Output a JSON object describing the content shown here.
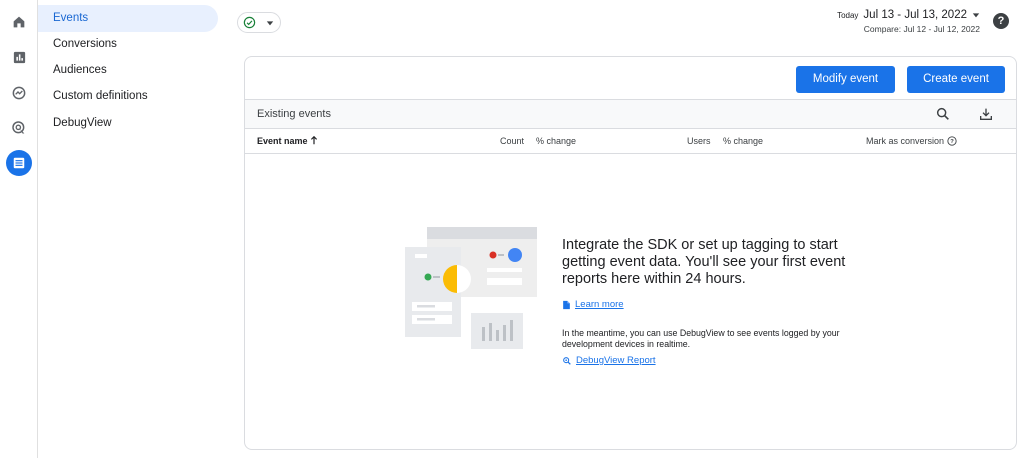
{
  "rail": {
    "items": [
      {
        "name": "home-icon"
      },
      {
        "name": "reports-icon"
      },
      {
        "name": "explore-icon"
      },
      {
        "name": "advertising-icon"
      },
      {
        "name": "configure-icon",
        "active": true
      }
    ]
  },
  "nav": {
    "items": [
      {
        "label": "Events",
        "active": true
      },
      {
        "label": "Conversions"
      },
      {
        "label": "Audiences"
      },
      {
        "label": "Custom definitions"
      },
      {
        "label": "DebugView"
      }
    ]
  },
  "header": {
    "today_label": "Today",
    "date_range": "Jul 13 - Jul 13, 2022",
    "compare": "Compare: Jul 12 - Jul 12, 2022",
    "help_label": "?"
  },
  "card": {
    "modify_label": "Modify event",
    "create_label": "Create event",
    "toolbar_title": "Existing events",
    "columns": {
      "event_name": "Event name",
      "count": "Count",
      "count_change": "% change",
      "users": "Users",
      "users_change": "% change",
      "mark_conversion": "Mark as conversion"
    },
    "empty": {
      "title": "Integrate the SDK or set up tagging to start getting event data. You'll see your first event reports here within 24 hours.",
      "learn_more": "Learn more",
      "meantime": "In the meantime, you can use DebugView to see events logged by your development devices in realtime.",
      "debugview_link": "DebugView Report"
    }
  },
  "colors": {
    "accent": "#1a73e8",
    "nav_active_bg": "#e8f0fe",
    "status_green": "#188038"
  }
}
